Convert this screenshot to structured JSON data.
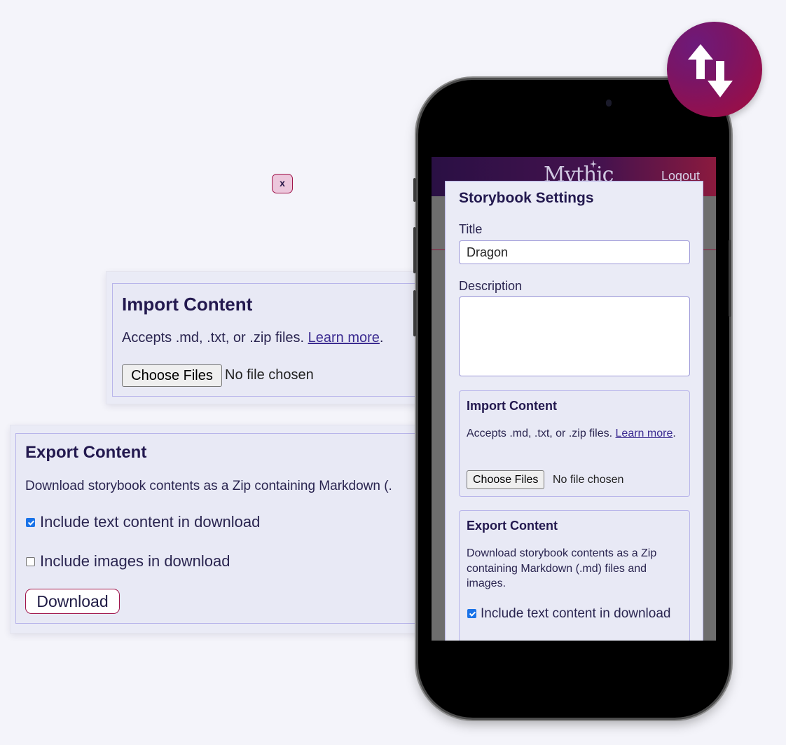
{
  "import_callout": {
    "title": "Import Content",
    "text": "Accepts .md, .txt, or .zip files. ",
    "link": "Learn more",
    "period": ".",
    "button": "Choose Files",
    "file_status": "No file chosen"
  },
  "export_callout": {
    "title": "Export Content",
    "text": "Download storybook contents as a Zip containing Markdown (.",
    "checkbox_text": {
      "label": "Include text content in download",
      "checked": true
    },
    "checkbox_images": {
      "label": "Include images in download",
      "checked": false
    },
    "download_button": "Download"
  },
  "app": {
    "logo": "Mythic",
    "logout": "Logout"
  },
  "modal": {
    "close": "x",
    "title": "Storybook Settings",
    "title_label": "Title",
    "title_value": "Dragon",
    "description_label": "Description",
    "description_value": "",
    "import": {
      "title": "Import Content",
      "text": "Accepts .md, .txt, or .zip files. ",
      "link": "Learn more",
      "period": ".",
      "button": "Choose Files",
      "file_status": "No file chosen"
    },
    "export": {
      "title": "Export Content",
      "text": "Download storybook contents as a Zip containing Markdown (.md) files and images.",
      "checkbox_text": {
        "label": "Include text content in download",
        "checked": true
      }
    }
  },
  "badge_icon": "up-down-arrows-icon",
  "colors": {
    "accent": "#a0144a",
    "primary_text": "#23194f",
    "panel_bg": "#eaebf6",
    "panel_border": "#b8b5ea",
    "badge_from": "#6d1a7a",
    "badge_to": "#a50c3c"
  }
}
